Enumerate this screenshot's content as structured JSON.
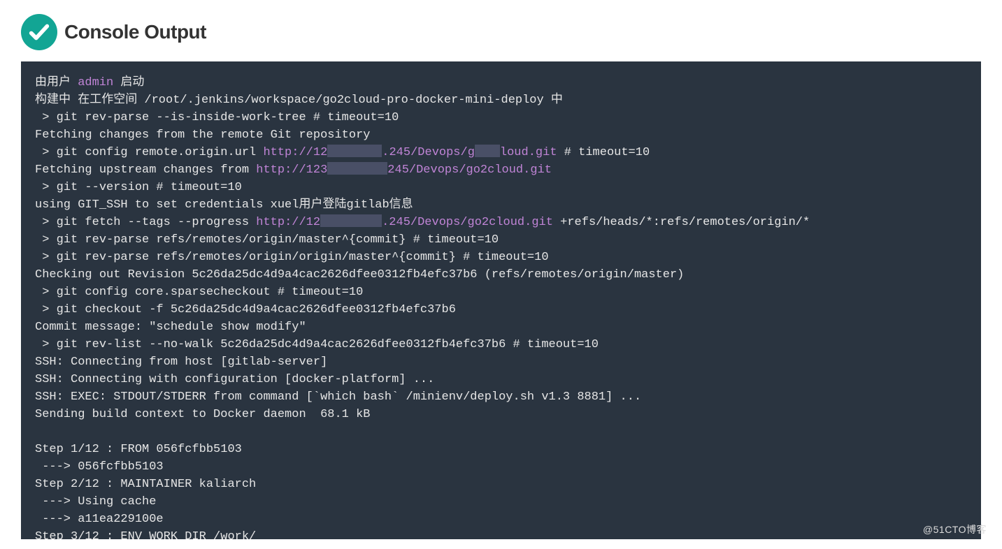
{
  "header": {
    "title": "Console Output"
  },
  "watermark": "@51CTO博客",
  "log": {
    "l1a": "由用户 ",
    "l1b": "admin",
    "l1c": " 启动",
    "l2": "构建中 在工作空间 /root/.jenkins/workspace/go2cloud-pro-docker-mini-deploy 中",
    "l3": " > git rev-parse --is-inside-work-tree # timeout=10",
    "l4": "Fetching changes from the remote Git repository",
    "l5a": " > git config remote.origin.url ",
    "l5b": "http://12",
    "l5c": ".245/Devops/g",
    "l5d": "loud.git",
    "l5e": " # timeout=10",
    "l6a": "Fetching upstream changes from ",
    "l6b": "http://123",
    "l6c": "245/Devops/go2cloud.git",
    "l7": " > git --version # timeout=10",
    "l8": "using GIT_SSH to set credentials xuel用户登陆gitlab信息",
    "l9a": " > git fetch --tags --progress ",
    "l9b": "http://12",
    "l9c": ".245/Devops/go2cloud.git",
    "l9d": " +refs/heads/*:refs/remotes/origin/*",
    "l10": " > git rev-parse refs/remotes/origin/master^{commit} # timeout=10",
    "l11": " > git rev-parse refs/remotes/origin/origin/master^{commit} # timeout=10",
    "l12": "Checking out Revision 5c26da25dc4d9a4cac2626dfee0312fb4efc37b6 (refs/remotes/origin/master)",
    "l13": " > git config core.sparsecheckout # timeout=10",
    "l14": " > git checkout -f 5c26da25dc4d9a4cac2626dfee0312fb4efc37b6",
    "l15": "Commit message: \"schedule show modify\"",
    "l16": " > git rev-list --no-walk 5c26da25dc4d9a4cac2626dfee0312fb4efc37b6 # timeout=10",
    "l17": "SSH: Connecting from host [gitlab-server]",
    "l18": "SSH: Connecting with configuration [docker-platform] ...",
    "l19": "SSH: EXEC: STDOUT/STDERR from command [`which bash` /minienv/deploy.sh v1.3 8881] ...",
    "l20": "Sending build context to Docker daemon  68.1 kB",
    "l21": "",
    "l22": "Step 1/12 : FROM 056fcfbb5103",
    "l23": " ---> 056fcfbb5103",
    "l24": "Step 2/12 : MAINTAINER kaliarch",
    "l25": " ---> Using cache",
    "l26": " ---> a11ea229100e",
    "l27": "Step 3/12 : ENV WORK_DIR /work/"
  }
}
